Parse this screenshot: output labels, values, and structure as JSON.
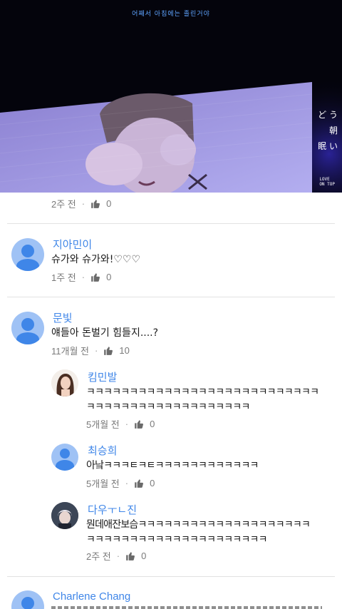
{
  "video": {
    "subtitle": "어째서 아침에는 졸린거야",
    "screen_text": [
      "ど う",
      "朝",
      "眠 い"
    ],
    "screen_logo": [
      "LOVE",
      "ON TOP"
    ]
  },
  "comments": {
    "partial_top": {
      "time": "2주 전",
      "likes": "0"
    },
    "c1": {
      "name": "지아민이",
      "text": "슈가와 슈가와!♡♡♡",
      "time": "1주 전",
      "likes": "0"
    },
    "c2": {
      "name": "문빛",
      "text": "얘들아 돈벌기 힘들지....?",
      "time": "11개월 전",
      "likes": "10",
      "replies": {
        "r1": {
          "name": "킴민발",
          "text_1": "ㅋㅋㅋㅋㅋㅋㅋㅋㅋㅋㅋㅋㅋㅋㅋㅋㅋㅋㅋㅋㅋㅋㅋㅋㅋㅋㅋ",
          "text_2": "ㅋㅋㅋㅋㅋㅋㅋㅋㅋㅋㅋㅋㅋㅋㅋㅋㅋㅋㅋ",
          "time": "5개월 전",
          "likes": "0"
        },
        "r2": {
          "name": "최승희",
          "text": "아낰ㅋㅋㅋㅌㅋㅌㅋㅋㅋㅋㅋㅋㅋㅋㅋㅋㅋㅋ",
          "time": "5개월 전",
          "likes": "0"
        },
        "r3": {
          "name": "다우ㅜㄴ진",
          "text_1": "뭔데애잔보슴ㅋㅋㅋㅋㅋㅋㅋㅋㅋㅋㅋㅋㅋㅋㅋㅋㅋㅋㅋㅋ",
          "text_2": "ㅋㅋㅋㅋㅋㅋㅋㅋㅋㅋㅋㅋㅋㅋㅋㅋㅋㅋㅋㅋㅋ",
          "time": "2주 전",
          "likes": "0"
        }
      }
    },
    "c3": {
      "name": "Charlene Chang"
    }
  },
  "colors": {
    "link_blue": "#3f86e8",
    "avatar_bg": "#9fc2f5",
    "meta_gray": "#7a7a7a",
    "divider": "#e2e2e2"
  },
  "icons": {
    "like": "thumbs-up-icon"
  }
}
